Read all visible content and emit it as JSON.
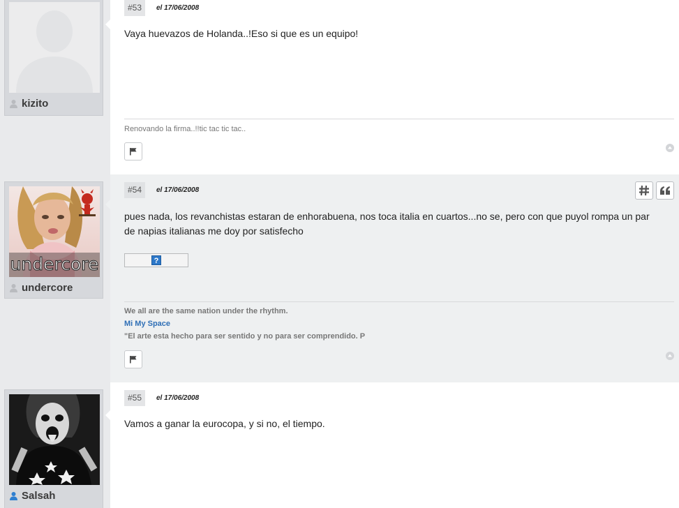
{
  "posts": [
    {
      "number": "#53",
      "date": "el 17/06/2008",
      "username": "kizito",
      "avatar": "default-avatar-silhouette",
      "text": "Vaya huevazos de Holanda..!Eso si que es un equipo!",
      "signature": [
        "Renovando la firma..!!tic tac tic tac.."
      ]
    },
    {
      "number": "#54",
      "date": "el 17/06/2008",
      "username": "undercore",
      "avatar": "photo-avatar",
      "avatar_text": "undercore",
      "text": "pues nada, los revanchistas estaran de enhorabuena, nos toca italia en cuartos...no se, pero con que puyol rompa un par de napias italianas me doy por satisfecho",
      "image_placeholder": "?",
      "signature": [
        "We all are the same nation under the rhythm.",
        "Mi My Space",
        "\"El arte esta hecho para ser sentido y no para ser comprendido. P"
      ]
    },
    {
      "number": "#55",
      "date": "el 17/06/2008",
      "username": "Salsah",
      "avatar": "photo-avatar-bw",
      "text": "Vamos a ganar la eurocopa, y si no, el tiempo."
    }
  ],
  "icons": {
    "flag": "flag-icon",
    "back_to_top": "arrow-up-icon",
    "permalink": "hash-icon",
    "quote": "quote-icon",
    "user_offline": "user-offline-icon",
    "user_online": "user-online-icon"
  },
  "colors": {
    "link": "#2f6fb6",
    "online_user": "#2f7fd0",
    "offline_user": "#b9bbbf"
  }
}
